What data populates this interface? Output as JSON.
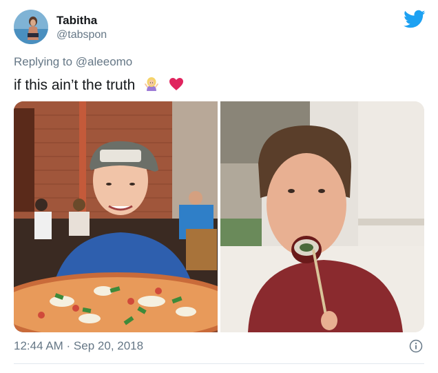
{
  "user": {
    "display_name": "Tabitha",
    "handle": "@tabspon"
  },
  "reply": {
    "prefix": "Replying to",
    "mention": "@aleeomo"
  },
  "tweet": {
    "text": "if this ain’t the truth",
    "emojis": [
      "woman-shrugging-emoji",
      "red-heart-emoji"
    ],
    "timestamp": "12:44 AM · Sep 20, 2018"
  },
  "media": {
    "count": 2
  },
  "colors": {
    "twitter_blue": "#1DA1F2",
    "secondary_text": "#657786",
    "heart_red": "#E0245E"
  },
  "icons": [
    "twitter-bird-icon",
    "info-icon"
  ]
}
